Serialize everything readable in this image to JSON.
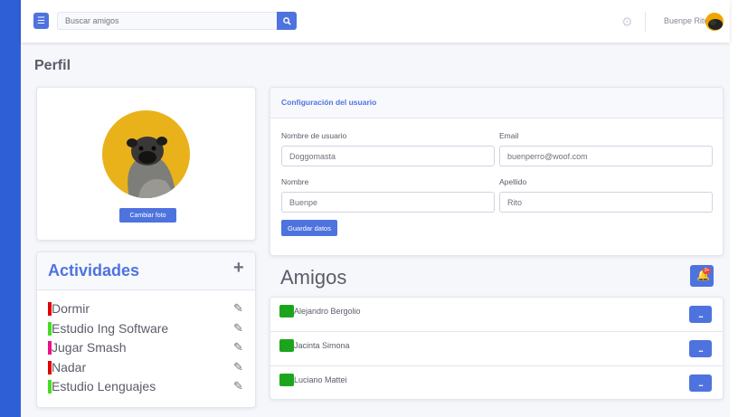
{
  "topbar": {
    "search_placeholder": "Buscar amigos",
    "user_name": "Buenpe Rito"
  },
  "page": {
    "title": "Perfil"
  },
  "profile": {
    "change_photo_label": "Cambiar foto"
  },
  "activities": {
    "title": "Actividades",
    "items": [
      {
        "label": "Dormir",
        "color": "#e00000"
      },
      {
        "label": "Estudio Ing Software",
        "color": "#44dd22"
      },
      {
        "label": "Jugar Smash",
        "color": "#ee1188"
      },
      {
        "label": "Nadar",
        "color": "#e00000"
      },
      {
        "label": "Estudio Lenguajes",
        "color": "#44dd22"
      }
    ]
  },
  "config": {
    "title": "Configuración del usuario",
    "username_label": "Nombre de usuario",
    "username_value": "Doggomasta",
    "email_label": "Email",
    "email_value": "buenperro@woof.com",
    "name_label": "Nombre",
    "name_value": "Buenpe",
    "surname_label": "Apellido",
    "surname_value": "Rito",
    "save_label": "Guardar datos"
  },
  "friends": {
    "title": "Amigos",
    "badge": "3+",
    "more_label": "...",
    "items": [
      {
        "name": "Alejandro Bergolio"
      },
      {
        "name": "Jacinta Simona"
      },
      {
        "name": "Luciano Mattei"
      }
    ]
  },
  "colors": {
    "accent": "#4e73df",
    "side_bar": "#2f5fd6",
    "badge": "#e74a3b",
    "avatar_green": "#1da41d"
  }
}
